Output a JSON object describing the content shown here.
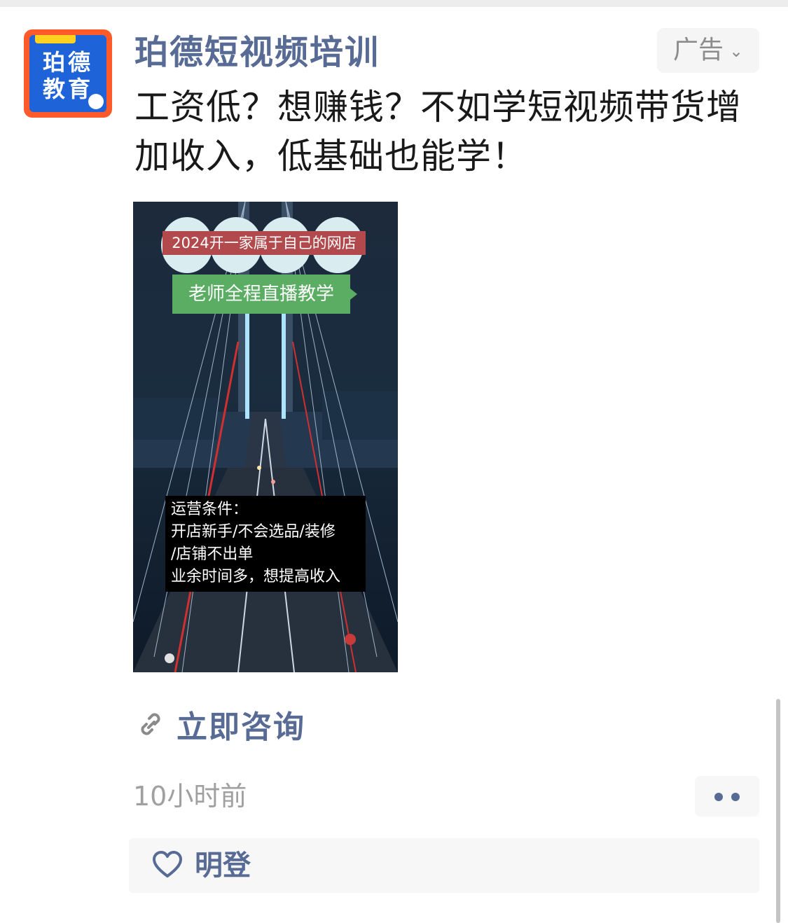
{
  "post": {
    "account_name": "珀德短视频培训",
    "avatar_text": [
      "珀德",
      "教育"
    ],
    "ad_label": "广告",
    "headline": "工资低？想赚钱？不如学短视频带货增加收入，低基础也能学！",
    "media": {
      "tag_top": "2024开一家属于自己的网店",
      "tag_green": "老师全程直播教学",
      "info_lines": [
        "运营条件：",
        "开店新手/不会选品/装修",
        "/店铺不出单",
        "业余时间多，想提高收入"
      ]
    },
    "cta_label": "立即咨询",
    "timestamp": "10小时前",
    "liker": "明登"
  },
  "colors": {
    "link_blue": "#576b95",
    "ad_chip_bg": "#f5f5f5",
    "tag_red": "#b24a4d",
    "tag_green": "#5aad62"
  },
  "icons": [
    "link-icon",
    "heart-icon",
    "chevron-down-icon",
    "more-dots-icon"
  ]
}
